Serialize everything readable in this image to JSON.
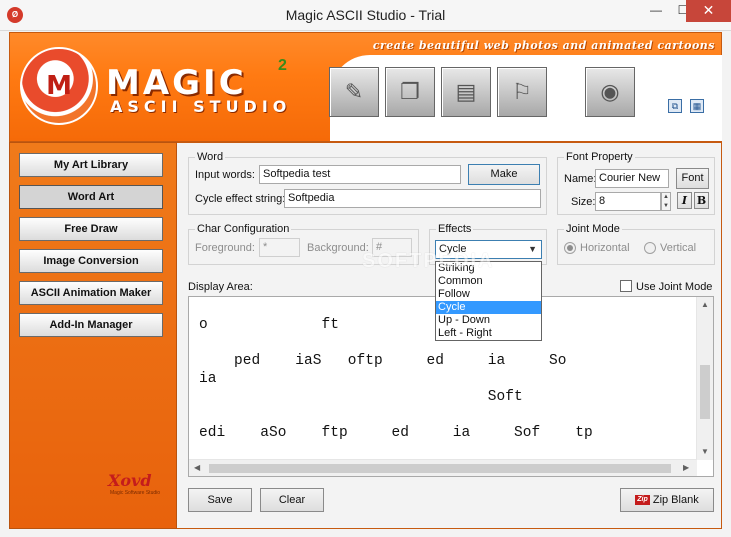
{
  "window": {
    "title": "Magic ASCII Studio - Trial",
    "icon_text": "Ø",
    "minimize": "—",
    "maximize": "☐",
    "close": "✕"
  },
  "banner": {
    "tagline": "create beautiful web photos and animated cartoons",
    "logo_main": "MAGIC",
    "logo_sub": "ASCII STUDIO",
    "logo_superscript": "2",
    "logo_badge": "M"
  },
  "toolbar_icons": [
    "wand-icon",
    "pages-icon",
    "document-icon",
    "run-icon",
    "globe-icon"
  ],
  "sidebar": {
    "items": [
      {
        "label": "My Art Library"
      },
      {
        "label": "Word Art"
      },
      {
        "label": "Free Draw"
      },
      {
        "label": "Image Conversion"
      },
      {
        "label": "ASCII Animation Maker"
      },
      {
        "label": "Add-In Manager"
      }
    ],
    "active_index": 1,
    "bottom_logo": "Xovd",
    "bottom_logo_sub": "Magic Software Studio"
  },
  "word": {
    "legend": "Word",
    "input_label": "Input words:",
    "input_value": "Softpedia test",
    "make_button": "Make",
    "cycle_label": "Cycle effect string:",
    "cycle_value": "Softpedia"
  },
  "font_property": {
    "legend": "Font Property",
    "name_label": "Name:",
    "name_value": "Courier New",
    "font_button": "Font",
    "size_label": "Size:",
    "size_value": "8",
    "italic_label": "I",
    "bold_label": "B"
  },
  "char_config": {
    "legend": "Char Configuration",
    "foreground_label": "Foreground:",
    "foreground_value": "*",
    "background_label": "Background:",
    "background_value": "#"
  },
  "effects": {
    "legend": "Effects",
    "selected": "Cycle",
    "options": [
      "Striking",
      "Common",
      "Follow",
      "Cycle",
      "Up - Down",
      "Left - Right"
    ],
    "selected_index": 3
  },
  "joint_mode": {
    "legend": "Joint Mode",
    "horizontal_label": "Horizontal",
    "vertical_label": "Vertical",
    "use_joint_label": "Use Joint Mode"
  },
  "display": {
    "label": "Display Area:",
    "lines": [
      "o             ft",
      "    ped    iaS   oftp     ed     ia     So",
      "ia",
      "                                 Soft",
      "edi    aSo    ftp     ed     ia     Sof    tp"
    ]
  },
  "footer": {
    "save_button": "Save",
    "clear_button": "Clear",
    "zip_button": "Zip Blank",
    "zip_icon_text": "Zip"
  },
  "watermark": "SOFTPEDIA"
}
